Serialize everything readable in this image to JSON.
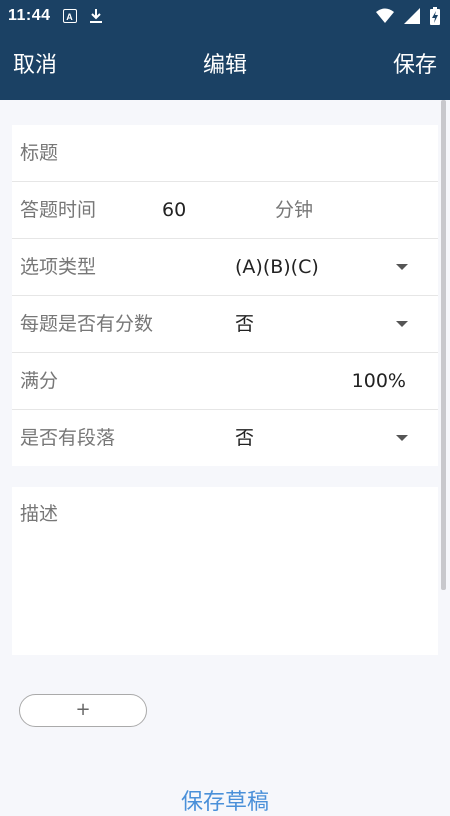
{
  "status_bar": {
    "time": "11:44",
    "notification_letter": "A",
    "icons": [
      "a-notification-icon",
      "download-icon",
      "wifi-icon",
      "signal-icon",
      "battery-charging-icon"
    ]
  },
  "app_bar": {
    "cancel_label": "取消",
    "title": "编辑",
    "save_label": "保存"
  },
  "form": {
    "title_placeholder": "标题",
    "time": {
      "label": "答题时间",
      "value": "60",
      "unit": "分钟"
    },
    "option_type": {
      "label": "选项类型",
      "value": "(A)(B)(C)"
    },
    "score_each": {
      "label": "每题是否有分数",
      "value": "否"
    },
    "full_score": {
      "label": "满分",
      "value": "100%"
    },
    "paragraph": {
      "label": "是否有段落",
      "value": "否"
    }
  },
  "description": {
    "placeholder": "描述"
  },
  "add_button": {
    "label": "+"
  },
  "save_draft": {
    "label": "保存草稿"
  },
  "colors": {
    "header": "#1b4164",
    "background": "#f6f7fb",
    "link": "#4a90d9"
  }
}
